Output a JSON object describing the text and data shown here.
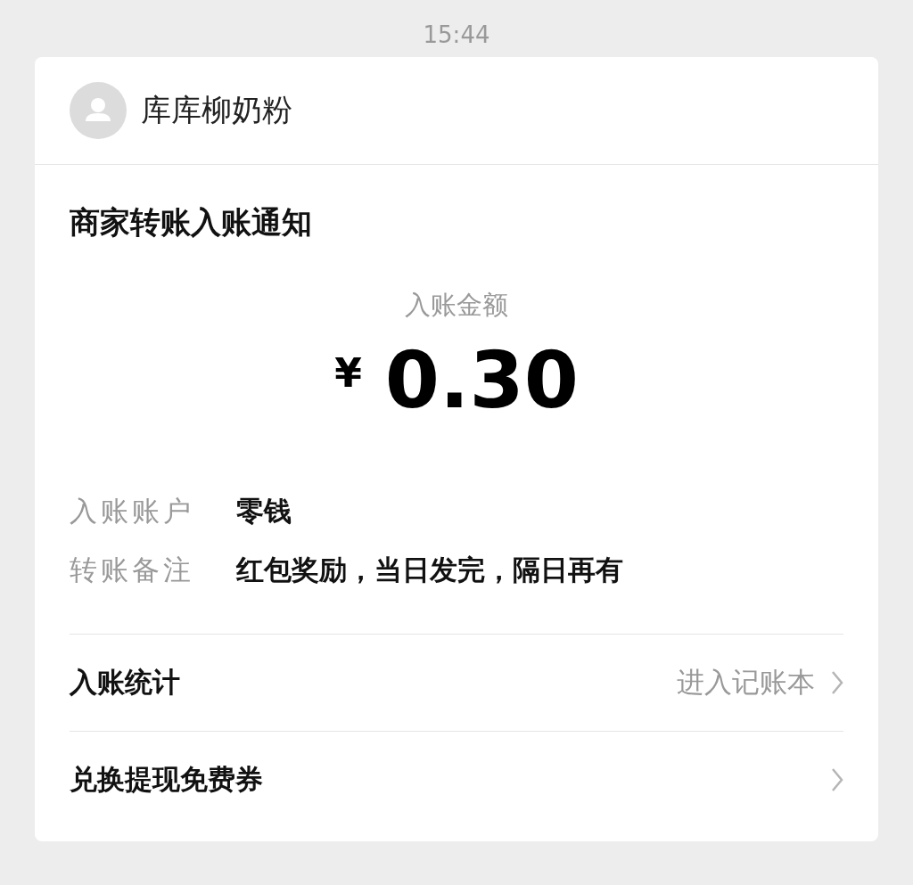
{
  "time": "15:44",
  "sender": {
    "name": "库库柳奶粉"
  },
  "title": "商家转账入账通知",
  "amount": {
    "label": "入账金额",
    "currency": "¥",
    "value": "0.30"
  },
  "details": [
    {
      "label": "入账账户",
      "value": "零钱"
    },
    {
      "label": "转账备注",
      "value": "红包奖励，当日发完，隔日再有"
    }
  ],
  "links": [
    {
      "label": "入账统计",
      "action": "进入记账本"
    },
    {
      "label": "兑换提现免费券"
    }
  ]
}
